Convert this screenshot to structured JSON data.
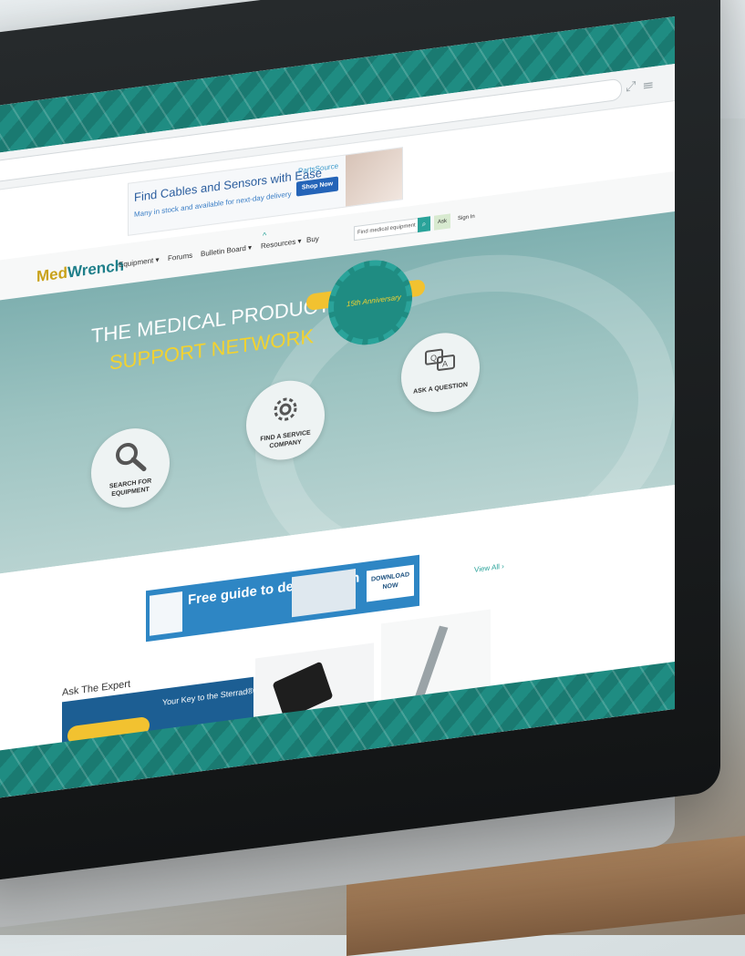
{
  "ad": {
    "title": "Find Cables and Sensors with Ease",
    "subtitle": "Many in stock and available for next-day delivery",
    "brand": "PartsSource",
    "button": "Shop Now"
  },
  "nav": {
    "logo_part1": "Med",
    "logo_part2": "Wrench",
    "items": [
      "Equipment ▾",
      "Forums",
      "Bulletin Board ▾",
      "Resources ▾",
      "Buy"
    ],
    "search_placeholder": "Find medical equipment",
    "ask_label": "Ask",
    "signin_label": "Sign In"
  },
  "hero": {
    "title_line1": "THE MEDICAL PRODUCT",
    "title_line2": "SUPPORT NETWORK",
    "badge_text": "15th Anniversary",
    "actions": [
      {
        "label": "SEARCH FOR EQUIPMENT",
        "icon": "magnifier-icon"
      },
      {
        "label": "FIND A SERVICE COMPANY",
        "icon": "gear-wrench-icon"
      },
      {
        "label": "ASK A QUESTION",
        "icon": "qa-bubbles-icon"
      }
    ]
  },
  "guide_banner": {
    "text": "Free guide to defibrillation",
    "cta": "DOWNLOAD NOW"
  },
  "lower": {
    "view_all": "View All ›",
    "section_title": "Ask The Expert",
    "card1_text": "Your Key to the Sterrad® NX™..."
  },
  "colors": {
    "brand_teal": "#1f8c82",
    "brand_yellow": "#f2d230",
    "accent_blue": "#2e86c4"
  }
}
